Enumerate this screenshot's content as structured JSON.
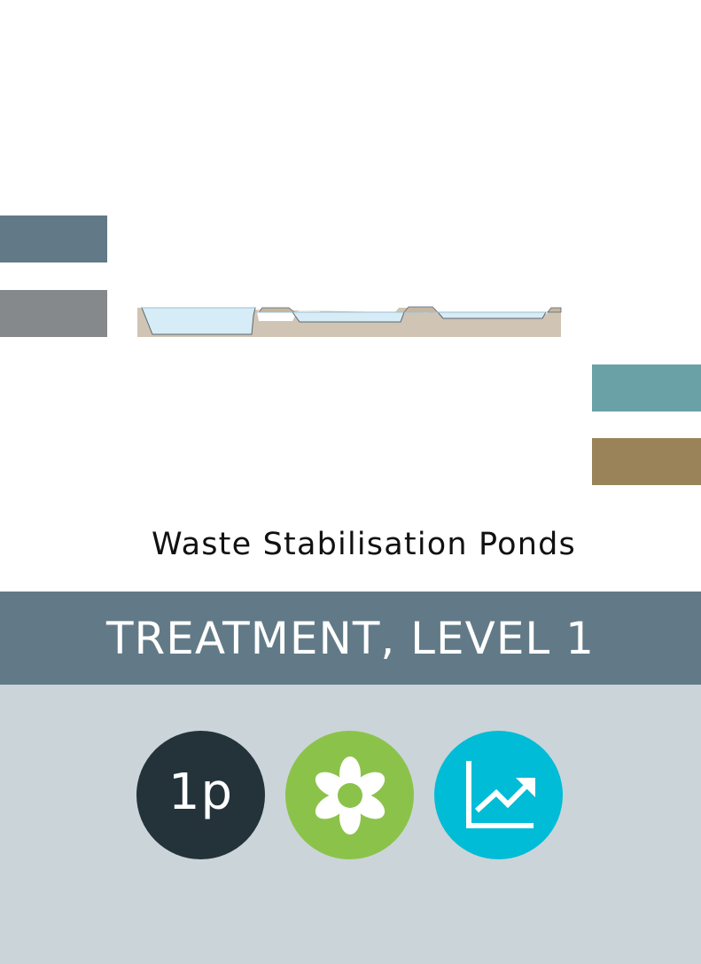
{
  "title": "Waste Stabilisation Ponds",
  "level": "TREATMENT, LEVEL 1",
  "badges": [
    {
      "label": "1p",
      "color": "#24333a"
    },
    {
      "icon": "flower-icon",
      "color": "#8bc34a"
    },
    {
      "icon": "line-chart-icon",
      "color": "#00bcd6"
    }
  ],
  "colors": {
    "bar_left_1": "#627a87",
    "bar_left_2": "#85898c",
    "bar_right_1": "#6aa1a6",
    "bar_right_2": "#9a8359",
    "ground": "#d0c4b4",
    "water": "#d6ecf6",
    "level_band": "#627a87",
    "icon_band": "#cbd4d9"
  }
}
